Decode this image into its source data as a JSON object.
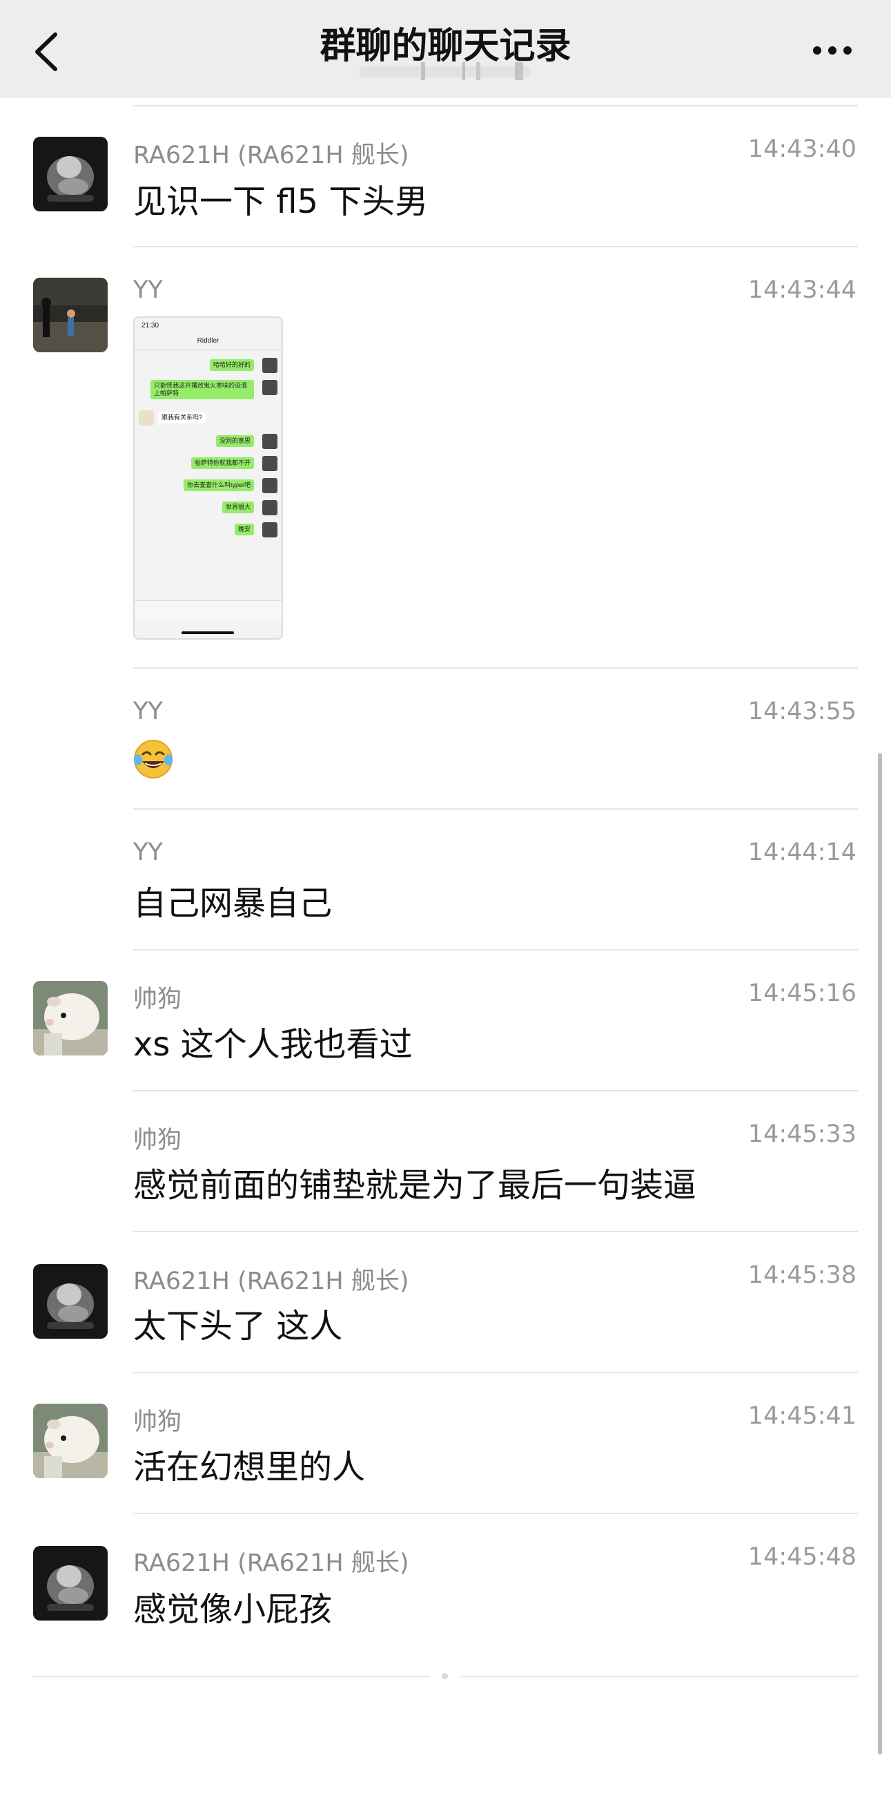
{
  "header": {
    "title": "群聊的聊天记录",
    "back_icon": "chevron-left-icon",
    "more_icon": "more-dots-icon"
  },
  "messages": [
    {
      "sender": "RA621H (RA621H 舰长)",
      "time": "14:43:40",
      "text": "见识一下 fl5 下头男",
      "avatar": "dark-figure-avatar"
    },
    {
      "sender": "YY",
      "time": "14:43:44",
      "text": "",
      "avatar": "night-photo-avatar",
      "image": true
    },
    {
      "sender": "YY",
      "time": "14:43:55",
      "text": "",
      "emoji": "tears-of-joy"
    },
    {
      "sender": "YY",
      "time": "14:44:14",
      "text": "自己网暴自己"
    },
    {
      "sender": "帅狗",
      "time": "14:45:16",
      "text": "xs 这个人我也看过",
      "avatar": "guinea-pig-avatar"
    },
    {
      "sender": "帅狗",
      "time": "14:45:33",
      "text": "感觉前面的铺垫就是为了最后一句装逼"
    },
    {
      "sender": "RA621H (RA621H 舰长)",
      "time": "14:45:38",
      "text": "太下头了 这人",
      "avatar": "dark-figure-avatar"
    },
    {
      "sender": "帅狗",
      "time": "14:45:41",
      "text": "活在幻想里的人",
      "avatar": "guinea-pig-avatar"
    },
    {
      "sender": "RA621H (RA621H 舰长)",
      "time": "14:45:48",
      "text": "感觉像小屁孩",
      "avatar": "dark-figure-avatar"
    }
  ],
  "screenshot": {
    "status_time": "21:30",
    "chat_title": "Riddler",
    "bubbles": [
      {
        "text": "哈哈好的好的",
        "out": true
      },
      {
        "text": "只能怪我这开播改鬼火意味的没混上帕萨特",
        "out": true
      },
      {
        "text": "跟我有关系吗?",
        "out": false
      },
      {
        "text": "没别的意思",
        "out": true
      },
      {
        "text": "帕萨特你就我都不开",
        "out": true
      },
      {
        "text": "你去查查什么叫typer吧",
        "out": true
      },
      {
        "text": "世界很大",
        "out": true
      },
      {
        "text": "晚安",
        "out": true
      }
    ]
  },
  "colors": {
    "nav_bg": "#ededed",
    "outgoing_bubble": "#95ec69",
    "divider": "#e5e5e5"
  }
}
